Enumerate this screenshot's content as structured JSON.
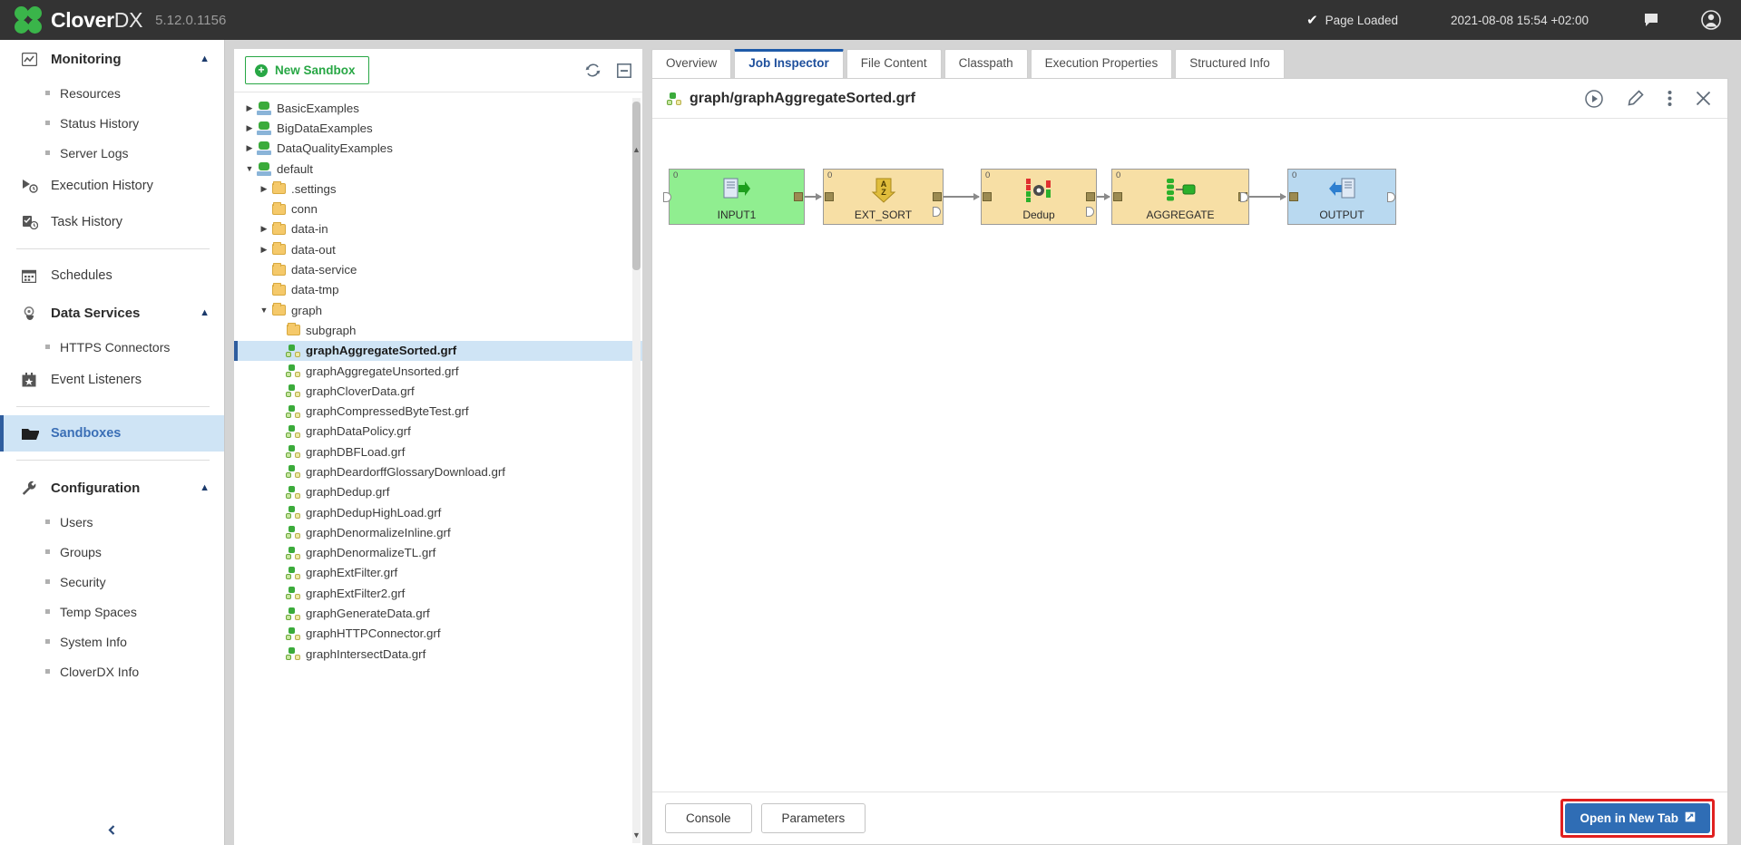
{
  "header": {
    "brand_clover": "Clover",
    "brand_dx": "DX",
    "version": "5.12.0.1156",
    "page_status": "Page Loaded",
    "check_icon": "check-icon",
    "timestamp": "2021-08-08 15:54 +02:00",
    "messages_icon": "message-icon",
    "user_icon": "user-account-icon"
  },
  "sidebar": {
    "groups": [
      {
        "label": "Monitoring",
        "icon": "monitoring-chart-icon",
        "expanded": true,
        "chevron": "chevron-up-icon",
        "children": [
          "Resources",
          "Status History",
          "Server Logs"
        ]
      }
    ],
    "monitoring_items": [
      {
        "label": "Execution History",
        "icon": "play-clock-icon"
      },
      {
        "label": "Task History",
        "icon": "task-clock-icon"
      }
    ],
    "schedules": {
      "label": "Schedules",
      "icon": "calendar-icon"
    },
    "data_services": {
      "label": "Data Services",
      "icon": "gear-hand-icon",
      "chevron": "chevron-up-icon",
      "children": [
        "HTTPS Connectors"
      ]
    },
    "event_listeners": {
      "label": "Event Listeners",
      "icon": "event-star-icon"
    },
    "sandboxes": {
      "label": "Sandboxes",
      "icon": "folder-open-icon",
      "active": true
    },
    "configuration": {
      "label": "Configuration",
      "icon": "wrench-icon",
      "chevron": "chevron-up-icon",
      "children": [
        "Users",
        "Groups",
        "Security",
        "Temp Spaces",
        "System Info",
        "CloverDX Info"
      ]
    },
    "collapse_icon": "chevron-left-icon"
  },
  "tree_panel": {
    "new_sandbox_label": "New Sandbox",
    "new_sandbox_icon": "plus-circle-icon",
    "refresh_icon": "refresh-icon",
    "collapse_all_icon": "collapse-all-icon",
    "rows": [
      {
        "label": "BasicExamples",
        "indent": 0,
        "twisty": "right",
        "icon": "sandbox-icon"
      },
      {
        "label": "BigDataExamples",
        "indent": 0,
        "twisty": "right",
        "icon": "sandbox-icon"
      },
      {
        "label": "DataQualityExamples",
        "indent": 0,
        "twisty": "right",
        "icon": "sandbox-icon"
      },
      {
        "label": "default",
        "indent": 0,
        "twisty": "down",
        "icon": "sandbox-icon"
      },
      {
        "label": ".settings",
        "indent": 1,
        "twisty": "right",
        "icon": "folder-icon"
      },
      {
        "label": "conn",
        "indent": 1,
        "twisty": "none",
        "icon": "folder-icon"
      },
      {
        "label": "data-in",
        "indent": 1,
        "twisty": "right",
        "icon": "folder-icon"
      },
      {
        "label": "data-out",
        "indent": 1,
        "twisty": "right",
        "icon": "folder-icon"
      },
      {
        "label": "data-service",
        "indent": 1,
        "twisty": "none",
        "icon": "folder-icon"
      },
      {
        "label": "data-tmp",
        "indent": 1,
        "twisty": "none",
        "icon": "folder-icon"
      },
      {
        "label": "graph",
        "indent": 1,
        "twisty": "down",
        "icon": "folder-icon"
      },
      {
        "label": "subgraph",
        "indent": 2,
        "twisty": "none",
        "icon": "folder-icon"
      },
      {
        "label": "graphAggregateSorted.grf",
        "indent": 2,
        "twisty": "none",
        "icon": "graph-icon",
        "selected": true
      },
      {
        "label": "graphAggregateUnsorted.grf",
        "indent": 2,
        "twisty": "none",
        "icon": "graph-icon"
      },
      {
        "label": "graphCloverData.grf",
        "indent": 2,
        "twisty": "none",
        "icon": "graph-icon"
      },
      {
        "label": "graphCompressedByteTest.grf",
        "indent": 2,
        "twisty": "none",
        "icon": "graph-icon"
      },
      {
        "label": "graphDataPolicy.grf",
        "indent": 2,
        "twisty": "none",
        "icon": "graph-icon"
      },
      {
        "label": "graphDBFLoad.grf",
        "indent": 2,
        "twisty": "none",
        "icon": "graph-icon"
      },
      {
        "label": "graphDeardorffGlossaryDownload.grf",
        "indent": 2,
        "twisty": "none",
        "icon": "graph-icon"
      },
      {
        "label": "graphDedup.grf",
        "indent": 2,
        "twisty": "none",
        "icon": "graph-icon"
      },
      {
        "label": "graphDedupHighLoad.grf",
        "indent": 2,
        "twisty": "none",
        "icon": "graph-icon"
      },
      {
        "label": "graphDenormalizeInline.grf",
        "indent": 2,
        "twisty": "none",
        "icon": "graph-icon"
      },
      {
        "label": "graphDenormalizeTL.grf",
        "indent": 2,
        "twisty": "none",
        "icon": "graph-icon"
      },
      {
        "label": "graphExtFilter.grf",
        "indent": 2,
        "twisty": "none",
        "icon": "graph-icon"
      },
      {
        "label": "graphExtFilter2.grf",
        "indent": 2,
        "twisty": "none",
        "icon": "graph-icon"
      },
      {
        "label": "graphGenerateData.grf",
        "indent": 2,
        "twisty": "none",
        "icon": "graph-icon"
      },
      {
        "label": "graphHTTPConnector.grf",
        "indent": 2,
        "twisty": "none",
        "icon": "graph-icon"
      },
      {
        "label": "graphIntersectData.grf",
        "indent": 2,
        "twisty": "none",
        "icon": "graph-icon"
      }
    ]
  },
  "main": {
    "tabs": [
      {
        "label": "Overview",
        "active": false
      },
      {
        "label": "Job Inspector",
        "active": true
      },
      {
        "label": "File Content",
        "active": false
      },
      {
        "label": "Classpath",
        "active": false
      },
      {
        "label": "Execution Properties",
        "active": false
      },
      {
        "label": "Structured Info",
        "active": false
      }
    ],
    "graph_title": "graph/graphAggregateSorted.grf",
    "graph_title_icon": "graph-icon",
    "actions": [
      {
        "name": "run-icon"
      },
      {
        "name": "edit-pencil-icon"
      },
      {
        "name": "more-vertical-icon"
      },
      {
        "name": "close-icon"
      }
    ],
    "graph_nodes": [
      {
        "name": "INPUT1",
        "port": "0",
        "color": "#90ee90",
        "glyph": "file-input-icon"
      },
      {
        "name": "EXT_SORT",
        "port": "0",
        "color": "#f7dfa5",
        "glyph": "sort-az-icon"
      },
      {
        "name": "Dedup",
        "port": "0",
        "color": "#f7dfa5",
        "glyph": "dedup-icon"
      },
      {
        "name": "AGGREGATE",
        "port": "0",
        "color": "#f7dfa5",
        "glyph": "aggregate-icon"
      },
      {
        "name": "OUTPUT",
        "port": "0",
        "color": "#b9d9f0",
        "glyph": "file-output-icon"
      }
    ],
    "footer": {
      "console_label": "Console",
      "parameters_label": "Parameters",
      "open_in_new_tab_label": "Open in New Tab",
      "open_in_new_tab_icon": "external-link-icon",
      "highlight_color": "#e02020"
    }
  }
}
